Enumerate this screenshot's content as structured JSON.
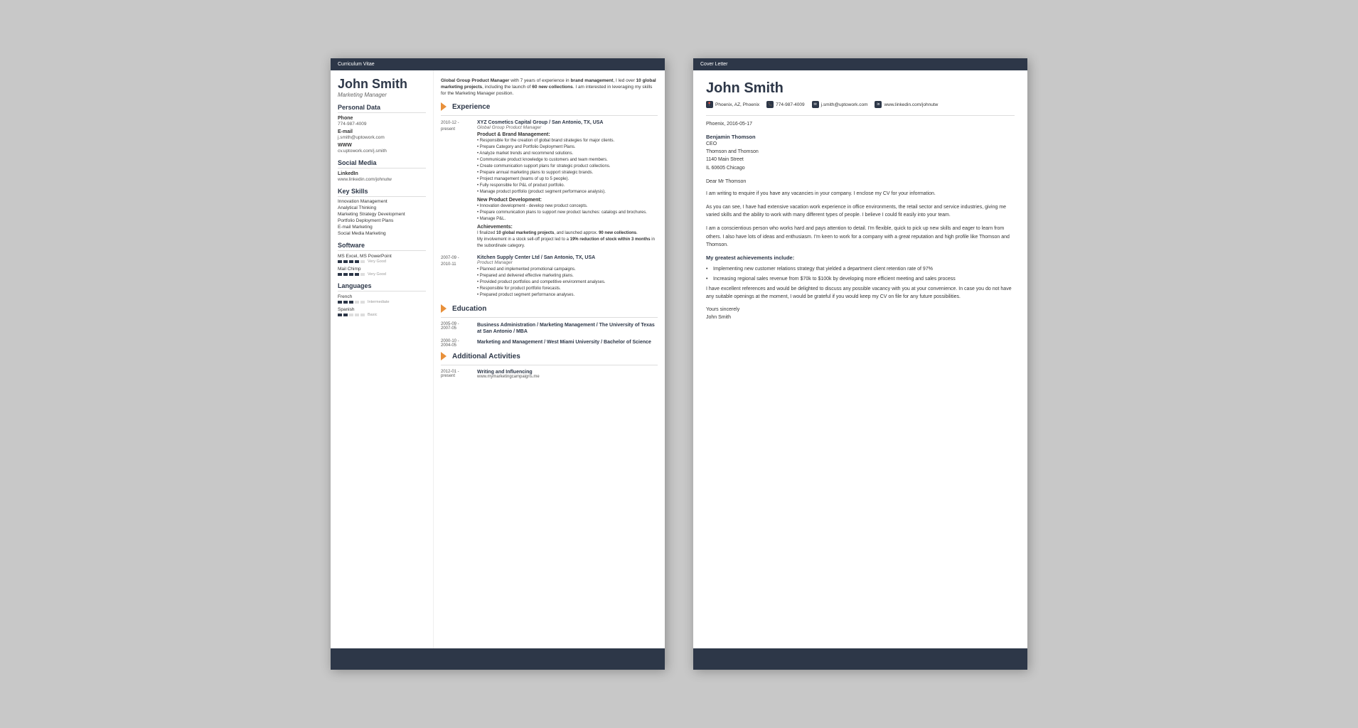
{
  "cv": {
    "header_label": "Curriculum Vitae",
    "footer_bar": "",
    "name": "John Smith",
    "title": "Marketing Manager",
    "summary": "Global Group Product Manager with 7 years of experience in brand management, I led over 10 global marketing projects, including the launch of 60 new collections. I am interested in leveraging my skills for the Marketing Manager position.",
    "sections": {
      "personal_data": "Personal Data",
      "phone_label": "Phone",
      "phone": "774-987-4009",
      "email_label": "E-mail",
      "email": "j.smith@uptowork.com",
      "www_label": "WWW",
      "www": "cv.uptowork.com/j.smith",
      "social_media": "Social Media",
      "linkedin_label": "LinkedIn",
      "linkedin": "www.linkedin.com/johnutw",
      "key_skills": "Key Skills",
      "skills": [
        "Innovation Management",
        "Analytical Thinking",
        "Marketing Strategy Development",
        "Portfolio Deployment Plans",
        "E-mail Marketing",
        "Social Media Marketing"
      ],
      "software": "Software",
      "software_items": [
        {
          "name": "MS Excel, MS PowerPoint",
          "rating": 4,
          "max": 5,
          "label": "Very Good"
        },
        {
          "name": "Mail Chimp",
          "rating": 4,
          "max": 5,
          "label": "Very Good"
        }
      ],
      "languages": "Languages",
      "language_items": [
        {
          "name": "French",
          "rating": 3,
          "max": 5,
          "label": "Intermediate"
        },
        {
          "name": "Spanish",
          "rating": 2,
          "max": 5,
          "label": "Basic"
        }
      ]
    },
    "experience": {
      "title": "Experience",
      "items": [
        {
          "date": "2010-12 - present",
          "company": "XYZ Cosmetics Capital Group / San Antonio, TX, USA",
          "role": "Global Group Product Manager",
          "sections": [
            {
              "title": "Product & Brand Management:",
              "bullets": [
                "Responsible for the creation of global brand strategies for major clients.",
                "Prepare Category and Portfolio Deployment Plans.",
                "Analyze market trends and recommend solutions.",
                "Communicate product knowledge to customers and team members.",
                "Create communication support plans for strategic product collections.",
                "Prepare annual marketing plans to support strategic brands.",
                "Project management (teams of up to 5 people).",
                "Fully responsible for P&L of product portfolio.",
                "Manage product portfolio (product segment performance analysis)."
              ]
            },
            {
              "title": "New Product Development:",
              "bullets": [
                "Innovation development - develop new product concepts.",
                "Prepare communication plans to support new product launches: catalogs and brochures.",
                "Manage P&L."
              ]
            }
          ],
          "achievements_title": "Achievements:",
          "achievements": [
            "I finalized 10 global marketing projects, and launched approx. 90 new collections.",
            "My involvement in a stock sell-off project led to a 19% reduction of stock within 3 months in the subordinate category."
          ]
        },
        {
          "date": "2007-09 - 2010-11",
          "company": "Kitchen Supply Center Ltd / San Antonio, TX, USA",
          "role": "Product Manager",
          "bullets": [
            "Planned and implemented promotional campaigns.",
            "Prepared and delivered effective marketing plans.",
            "Provided product portfolios and competitive environment analyses.",
            "Responsible for product portfolio forecasts.",
            "Prepared product segment performance analyses."
          ]
        }
      ]
    },
    "education": {
      "title": "Education",
      "items": [
        {
          "date": "2005-09 - 2007-05",
          "degree": "Business Administration / Marketing Management / The University of Texas at San Antonio / MBA"
        },
        {
          "date": "2000-10 - 2004-05",
          "degree": "Marketing and Management / West Miami University / Bachelor of Science"
        }
      ]
    },
    "activities": {
      "title": "Additional Activities",
      "items": [
        {
          "date": "2012-01 - present",
          "title": "Writing and Influencing",
          "detail": "www.mymarketingcampaigns.me"
        }
      ]
    }
  },
  "cover_letter": {
    "header_label": "Cover Letter",
    "name": "John Smith",
    "contact": {
      "location": "Phoenix, AZ, Phoenix",
      "phone": "774-987-4009",
      "email": "j.smith@uptowork.com",
      "linkedin": "www.linkedin.com/johnutw"
    },
    "date": "Phoenix, 2016-05-17",
    "recipient": {
      "name": "Benjamin Thomson",
      "title": "CEO",
      "company": "Thomson and Thomson",
      "address": "1140 Main Street",
      "city": "IL 60605 Chicago"
    },
    "salutation": "Dear Mr Thomson",
    "paragraphs": [
      "I am writing to enquire if you have any vacancies in your company. I enclose my CV for your information.",
      "As you can see, I have had extensive vacation work experience in office environments, the retail sector and service industries, giving me varied skills and the ability to work with many different types of people. I believe I could fit easily into your team.",
      "I am a conscientious person who works hard and pays attention to detail. I'm flexible, quick to pick up new skills and eager to learn from others. I also have lots of ideas and enthusiasm. I'm keen to work for a company with a great reputation and high profile like Thomson and Thomson."
    ],
    "achievements_title": "My greatest achievements include:",
    "achievements": [
      "Implementing new customer relations strategy that yielded a department client retention rate of 97%",
      "Increasing regional sales revenue from $70k to $100k by developing more efficient meeting and sales process"
    ],
    "closing_paragraph": "I have excellent references and would be delighted to discuss any possible vacancy with you at your convenience. In case you do not have any suitable openings at the moment, I would be grateful if you would keep my CV on file for any future possibilities.",
    "closing": "Yours sincerely",
    "signature": "John Smith"
  }
}
